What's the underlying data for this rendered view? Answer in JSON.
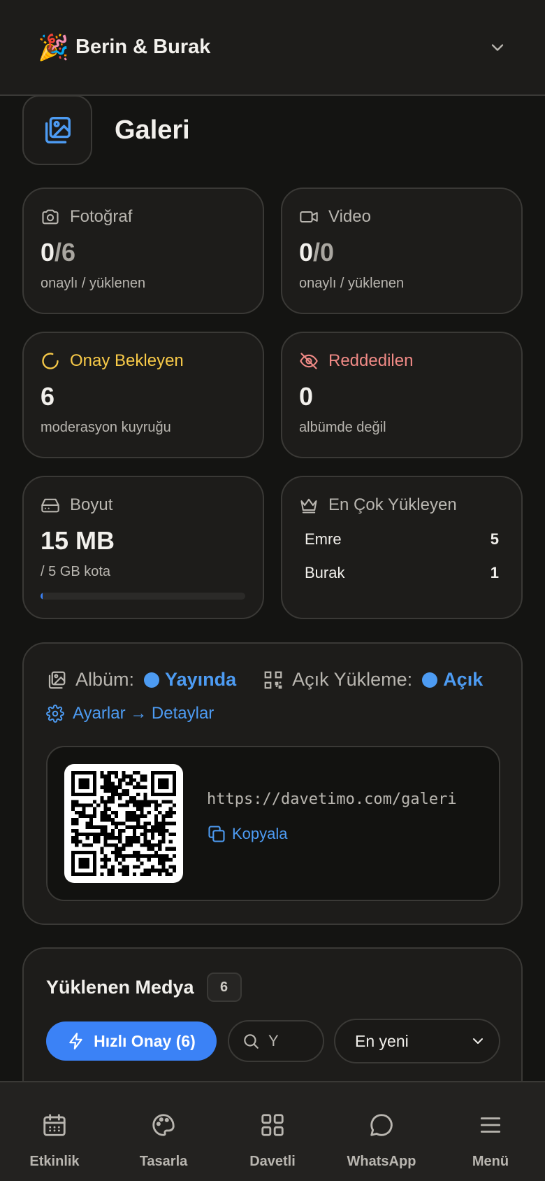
{
  "header": {
    "party_icon": "party-popper-icon",
    "event_name": "Berin & Burak"
  },
  "page": {
    "title": "Galeri"
  },
  "stats": {
    "photo": {
      "label": "Fotoğraf",
      "approved": "0",
      "uploaded": "/6",
      "sub": "onaylı / yüklenen"
    },
    "video": {
      "label": "Video",
      "approved": "0",
      "uploaded": "/0",
      "sub": "onaylı / yüklenen"
    },
    "pending": {
      "label": "Onay Bekleyen",
      "value": "6",
      "sub": "moderasyon kuyruğu",
      "color": "#f7c948"
    },
    "rejected": {
      "label": "Reddedilen",
      "value": "0",
      "sub": "albümde değil",
      "color": "#f08a86"
    },
    "size": {
      "label": "Boyut",
      "value": "15 MB",
      "sub": "/ 5 GB kota",
      "quota_fraction": 0.003
    },
    "top_uploaders": {
      "label": "En Çok Yükleyen",
      "rows": [
        {
          "name": "Emre",
          "count": "5"
        },
        {
          "name": "Burak",
          "count": "1"
        }
      ]
    }
  },
  "album": {
    "album_label": "Albüm:",
    "album_status": "Yayında",
    "open_upload_label": "Açık Yükleme:",
    "open_upload_status": "Açık",
    "settings_link": "Ayarlar → Detaylar",
    "url": "https://davetimo.com/galeri",
    "copy_label": "Kopyala"
  },
  "media": {
    "title": "Yüklenen Medya",
    "count": "6",
    "fast_approve": "Hızlı Onay (6)",
    "search_value": "Y",
    "sort_selected": "En yeni"
  },
  "nav": [
    {
      "label": "Etkinlik",
      "icon": "calendar-icon"
    },
    {
      "label": "Tasarla",
      "icon": "palette-icon"
    },
    {
      "label": "Davetli",
      "icon": "grid-icon"
    },
    {
      "label": "WhatsApp",
      "icon": "chat-bubble-icon"
    },
    {
      "label": "Menü",
      "icon": "hamburger-menu-icon"
    }
  ],
  "colors": {
    "accent": "#3b82f6",
    "link": "#4d9bf2",
    "background": "#141412",
    "card": "#1d1c1a"
  }
}
